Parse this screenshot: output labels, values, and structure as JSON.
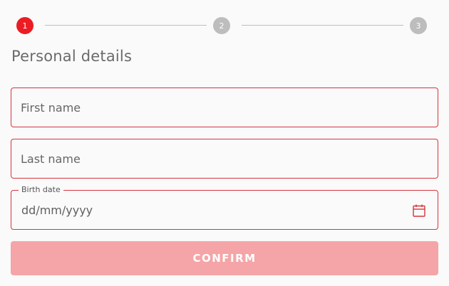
{
  "stepper": {
    "steps": [
      {
        "number": "1",
        "state": "active",
        "color": "#ec1c24"
      },
      {
        "number": "2",
        "state": "inactive",
        "color": "#bdbdbd"
      },
      {
        "number": "3",
        "state": "inactive",
        "color": "#bdbdbd"
      }
    ]
  },
  "form": {
    "title": "Personal details",
    "first_name": {
      "placeholder": "First name",
      "value": ""
    },
    "last_name": {
      "placeholder": "Last name",
      "value": ""
    },
    "birth_date": {
      "label": "Birth date",
      "placeholder": "dd/mm/yyyy",
      "icon": "calendar-icon"
    },
    "confirm_label": "CONFIRM"
  },
  "colors": {
    "accent": "#ec1c24",
    "field_border": "#d6343d",
    "button_disabled": "#f5a5a7",
    "inactive_step": "#bdbdbd"
  }
}
